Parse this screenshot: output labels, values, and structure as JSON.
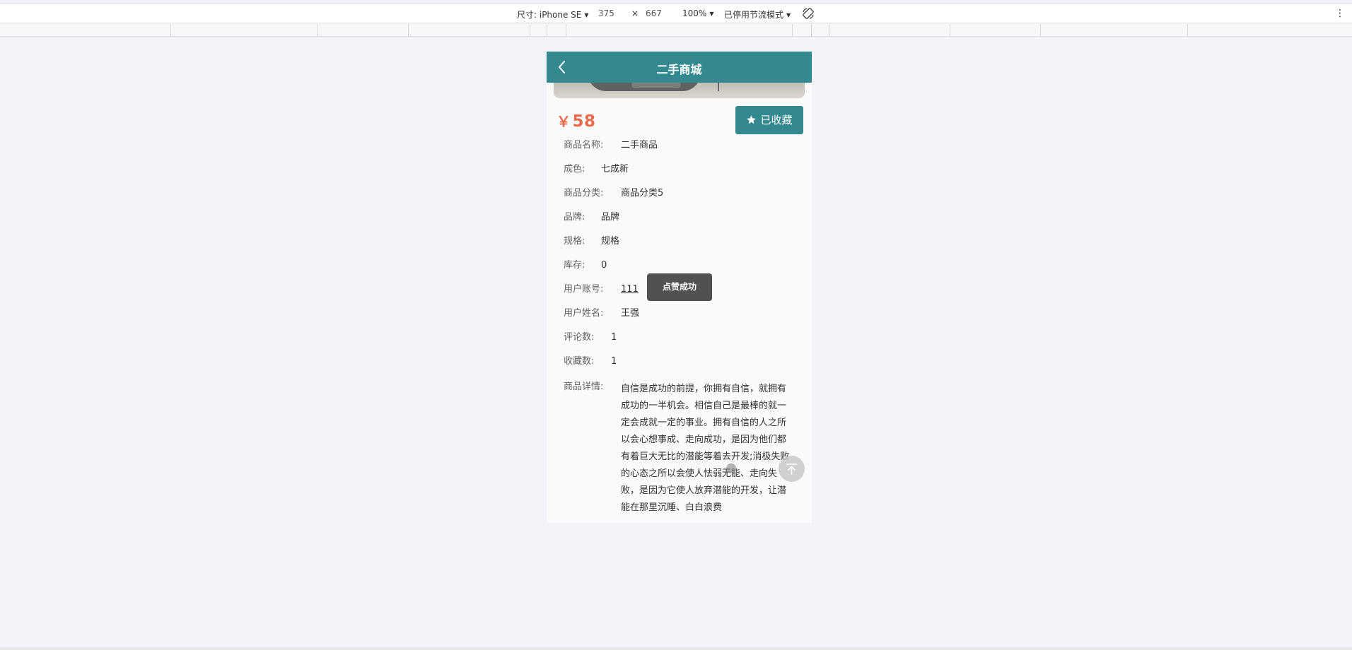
{
  "devtools": {
    "device_label": "尺寸: iPhone SE",
    "width": "375",
    "times": "×",
    "height": "667",
    "zoom": "100%",
    "throttle": "已停用节流模式",
    "more_icon": "vertical-dots-icon",
    "rotate_icon": "rotate-icon"
  },
  "app": {
    "title": "二手商城",
    "back_icon": "chevron-left-icon",
    "theme_color": "#33898f",
    "price_color": "#e76a4c"
  },
  "product": {
    "currency": "￥",
    "price": "58",
    "favorite_label": "已收藏",
    "favorite_icon": "star-icon",
    "fields": [
      {
        "label": "商品名称:",
        "value": "二手商品"
      },
      {
        "label": "成色:",
        "value": "七成新"
      },
      {
        "label": "商品分类:",
        "value": "商品分类5"
      },
      {
        "label": "品牌:",
        "value": "品牌"
      },
      {
        "label": "规格:",
        "value": "规格"
      },
      {
        "label": "库存:",
        "value": "0"
      },
      {
        "label": "用户账号:",
        "value": "111"
      },
      {
        "label": "用户姓名:",
        "value": "王强"
      },
      {
        "label": "评论数:",
        "value": "1"
      },
      {
        "label": "收藏数:",
        "value": "1"
      }
    ],
    "detail_label": "商品详情:",
    "detail_text": "自信是成功的前提，你拥有自信，就拥有成功的一半机会。相信自己是最棒的就一定会成就一定的事业。拥有自信的人之所以会心想事成、走向成功，是因为他们都有着巨大无比的潜能等着去开发;消极失败的心态之所以会使人怯弱无能、走向失败，是因为它使人放弃潜能的开发，让潜能在那里沉睡、白白浪费"
  },
  "toast": {
    "message": "点赞成功"
  },
  "back_to_top_icon": "arrow-up-icon"
}
